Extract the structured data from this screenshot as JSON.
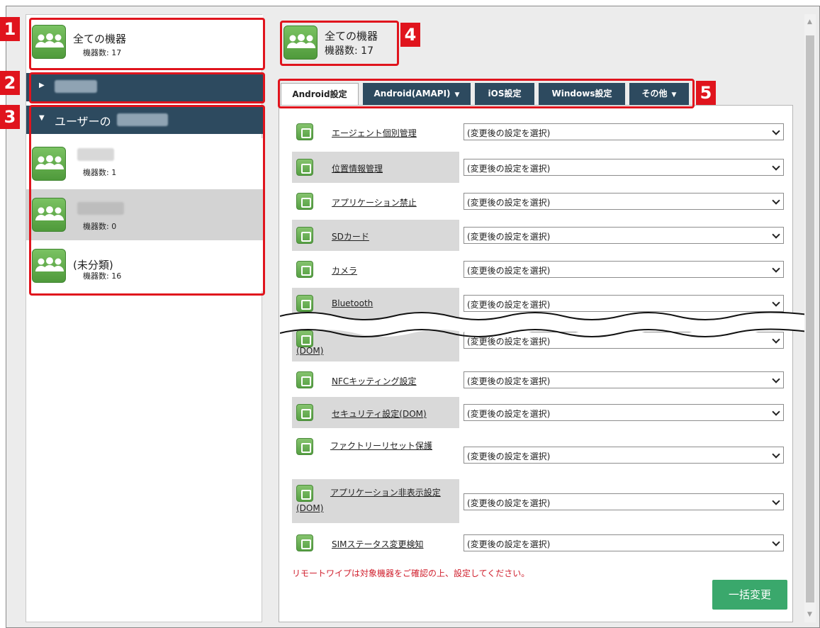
{
  "sidebar": {
    "all_devices": {
      "title": "全ての機器",
      "count": "機器数: 17"
    },
    "section_collapsed": {
      "label": ""
    },
    "section_expanded": {
      "label": "ユーザーの"
    },
    "groups": [
      {
        "name": "",
        "count": "機器数: 1"
      },
      {
        "name": "",
        "count": "機器数: 0"
      },
      {
        "name": "(未分類)",
        "count": "機器数: 16"
      }
    ]
  },
  "header": {
    "title": "全ての機器",
    "count": "機器数: 17"
  },
  "tabs": [
    {
      "label": "Android設定"
    },
    {
      "label": "Android(AMAPI)"
    },
    {
      "label": "iOS設定"
    },
    {
      "label": "Windows設定"
    },
    {
      "label": "その他"
    }
  ],
  "settings": [
    {
      "label": "エージェント個別管理",
      "value": "(変更後の設定を選択)"
    },
    {
      "label": "位置情報管理",
      "value": "(変更後の設定を選択)"
    },
    {
      "label": "アプリケーション禁止",
      "value": "(変更後の設定を選択)"
    },
    {
      "label": "SDカード",
      "value": "(変更後の設定を選択)"
    },
    {
      "label": "カメラ",
      "value": "(変更後の設定を選択)"
    },
    {
      "label": "Bluetooth",
      "value": "(変更後の設定を選択)"
    },
    {
      "label": "(DOM)",
      "value": "(変更後の設定を選択)"
    },
    {
      "label": "NFCキッティング設定",
      "value": "(変更後の設定を選択)"
    },
    {
      "label": "セキュリティ設定(DOM)",
      "value": "(変更後の設定を選択)"
    },
    {
      "label": "ファクトリーリセット保護",
      "value": "(変更後の設定を選択)"
    },
    {
      "label": "アプリケーション非表示設定(DOM)",
      "value": "(変更後の設定を選択)"
    },
    {
      "label": "SIMステータス変更検知",
      "value": "(変更後の設定を選択)"
    }
  ],
  "warning": "リモートワイプは対象機器をご確認の上、設定してください。",
  "bulk_button": "一括変更",
  "annotations": [
    "1",
    "2",
    "3",
    "4",
    "5"
  ],
  "icons": {
    "group": "users-group-icon",
    "expand": "triangle-right-icon",
    "collapse": "triangle-down-icon",
    "tab_dropdown": "caret-down-icon",
    "select": "chevron-down-icon"
  },
  "colors": {
    "nav_dark": "#2d4a5f",
    "accent_green": "#3aa86c",
    "annotation_red": "#e0141d",
    "warning_red": "#d0202e"
  }
}
